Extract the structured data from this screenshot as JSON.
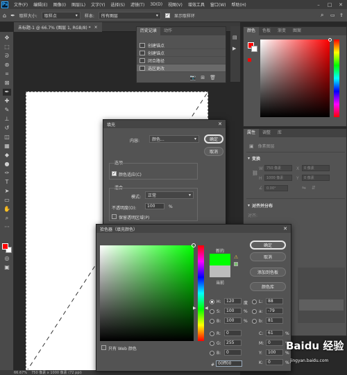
{
  "menubar": {
    "logo": "Ps",
    "items": [
      "文件(F)",
      "编辑(E)",
      "图像(I)",
      "图层(L)",
      "文字(Y)",
      "选择(S)",
      "滤镜(T)",
      "3D(D)",
      "视图(V)",
      "增效工具",
      "窗口(W)",
      "帮助(H)"
    ]
  },
  "options": {
    "size_label": "取样大小:",
    "size_value": "取样点",
    "sample_label": "样本:",
    "sample_value": "所有图层",
    "ring_label": "显示取样环"
  },
  "doc_tab": {
    "title": "未标题-1 @ 66.7% (图层 1, RGB/8) *"
  },
  "status": {
    "zoom": "66.67%",
    "info": "750 像素 x 1000 像素 (72 ppi)"
  },
  "history_panel": {
    "tabs": [
      "历史记录",
      "动作"
    ],
    "items": [
      "创建锚点",
      "创建锚点",
      "闭合路径",
      "选区更改"
    ]
  },
  "color_panel": {
    "tabs": [
      "颜色",
      "色板",
      "渐变",
      "图案"
    ]
  },
  "properties_panel": {
    "tabs": [
      "属性",
      "调整",
      "库"
    ],
    "layer_label": "像素图层",
    "transform_title": "变换",
    "w_label": "W",
    "w_value": "750 像素",
    "h_label": "H",
    "h_value": "1000 像素",
    "x_label": "X",
    "x_value": "0 像素",
    "y_label": "Y",
    "y_value": "0 像素",
    "angle_value": "0.00°",
    "align_title": "对齐并分布",
    "align_sub": "对齐:"
  },
  "fill_dialog": {
    "title": "填充",
    "content_label": "内容:",
    "content_value": "颜色...",
    "ok": "确定",
    "cancel": "取消",
    "options_title": "选项",
    "color_adapt": "颜色适应(C)",
    "blend_title": "混合",
    "mode_label": "模式:",
    "mode_value": "正常",
    "opacity_label": "不透明度(O):",
    "opacity_value": "100",
    "opacity_unit": "%",
    "preserve": "保留透明区域(P)"
  },
  "picker": {
    "title": "拾色器（填充颜色）",
    "ok": "确定",
    "cancel": "取消",
    "add_swatch": "添加到色板",
    "color_lib": "颜色库",
    "new_label": "新的",
    "current_label": "当前",
    "web_only": "只有 Web 颜色",
    "H": {
      "label": "H:",
      "value": "120",
      "unit": "度"
    },
    "S": {
      "label": "S:",
      "value": "100",
      "unit": "%"
    },
    "Bv": {
      "label": "B:",
      "value": "100",
      "unit": "%"
    },
    "R": {
      "label": "R:",
      "value": "0"
    },
    "G": {
      "label": "G:",
      "value": "255"
    },
    "B2": {
      "label": "B:",
      "value": "0"
    },
    "L": {
      "label": "L:",
      "value": "88"
    },
    "a": {
      "label": "a:",
      "value": "-79"
    },
    "b": {
      "label": "b:",
      "value": "81"
    },
    "C": {
      "label": "C:",
      "value": "61",
      "unit": "%"
    },
    "M": {
      "label": "M:",
      "value": "0",
      "unit": "%"
    },
    "Y": {
      "label": "Y:",
      "value": "100",
      "unit": "%"
    },
    "K": {
      "label": "K:",
      "value": "0",
      "unit": "%"
    },
    "hex_label": "#",
    "hex": "00ff00",
    "new_color": "#00ff00",
    "current_color": "#bdbdbd"
  },
  "watermark": {
    "main": "Baidu 经验",
    "sub": "jingyan.baidu.com"
  },
  "colors": {
    "fg": "#ff0000",
    "bg": "#ffffff"
  }
}
